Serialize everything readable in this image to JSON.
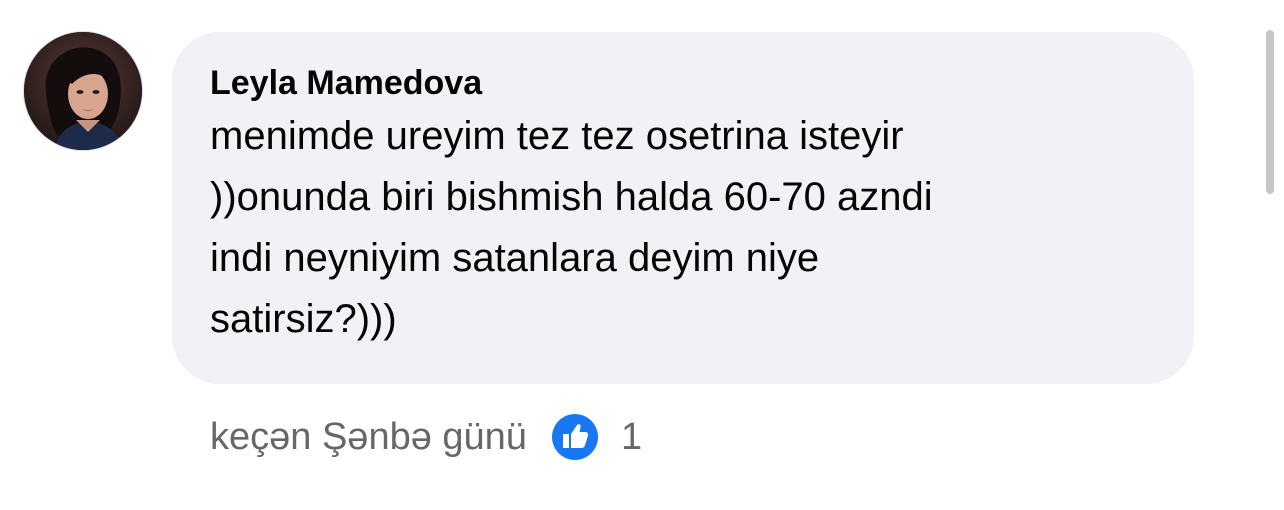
{
  "comment": {
    "author": "Leyla Mamedova",
    "text_lines": [
      "menimde ureyim tez tez osetrina isteyir",
      "))onunda biri bishmish halda 60-70 azndi",
      "indi neyniyim satanlara deyim niye",
      "satirsiz?)))"
    ],
    "timestamp": "keçən Şənbə günü",
    "reaction": {
      "icon": "like-icon",
      "count": "1",
      "color": "#1877f2"
    }
  },
  "colors": {
    "bubble": "#f0f2f5",
    "text": "#050505",
    "secondary_text": "#65676b",
    "like_blue": "#1877f2"
  }
}
